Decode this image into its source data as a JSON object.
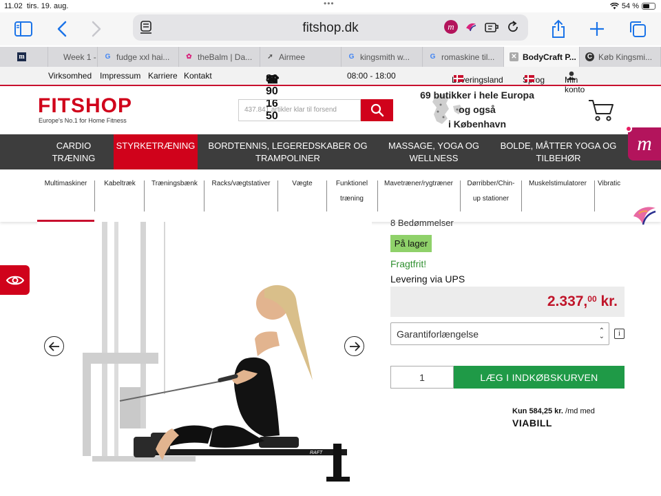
{
  "status": {
    "time": "11.02",
    "date": "tirs. 19. aug.",
    "battery": "54 %"
  },
  "browser": {
    "url": "fitshop.dk",
    "tabs": [
      {
        "label": "",
        "favicon": "m"
      },
      {
        "label": "Week 1 -",
        "favicon": ""
      },
      {
        "label": "fudge xxl hai...",
        "favicon": "G"
      },
      {
        "label": "theBalm | Da...",
        "favicon": "pink"
      },
      {
        "label": "Airmee",
        "favicon": "arrow"
      },
      {
        "label": "kingsmith w...",
        "favicon": "G"
      },
      {
        "label": "romaskine til...",
        "favicon": "G"
      },
      {
        "label": "BodyCraft P...",
        "favicon": "x",
        "active": true
      },
      {
        "label": "Køb Kingsmi...",
        "favicon": "C"
      }
    ]
  },
  "topbar": {
    "links": [
      "Virksomhed",
      "Impressum",
      "Karriere",
      "Kontakt"
    ],
    "phone": "80 90 16 50",
    "hours": "08:00 - 18:00",
    "country_label": "Leveringsland",
    "language_label": "Sprog",
    "account_label": "Min konto"
  },
  "header": {
    "logo": "FITSHOP",
    "tagline": "Europe's No.1 for Home Fitness",
    "search_placeholder": "437.841 artikler klar til forsend",
    "stores_line1": "69 butikker i hele Europa",
    "stores_line2": "og også",
    "stores_line3": "i København"
  },
  "mainnav": [
    {
      "line1": "CARDIO",
      "line2": "TRÆNING"
    },
    {
      "line1": "STYRKETRÆNING",
      "line2": "",
      "active": true
    },
    {
      "line1": "BORDTENNIS, LEGEREDSKABER OG",
      "line2": "TRAMPOLINER"
    },
    {
      "line1": "MASSAGE, YOGA OG",
      "line2": "WELLNESS"
    },
    {
      "line1": "BOLDE, MÅTTER YOGA OG",
      "line2": "TILBEHØR"
    }
  ],
  "subnav": [
    {
      "line1": "Multimaskiner",
      "line2": ""
    },
    {
      "line1": "Kabeltræk",
      "line2": ""
    },
    {
      "line1": "Træningsbænk",
      "line2": ""
    },
    {
      "line1": "Racks/vægtstativer",
      "line2": ""
    },
    {
      "line1": "Vægte",
      "line2": ""
    },
    {
      "line1": "Funktionel",
      "line2": "træning"
    },
    {
      "line1": "Mavetræner/rygtræner",
      "line2": ""
    },
    {
      "line1": "Dørribber/Chin-",
      "line2": "up stationer"
    },
    {
      "line1": "Muskelstimulatorer",
      "line2": ""
    },
    {
      "line1": "Vibratic",
      "line2": ""
    }
  ],
  "product": {
    "ratings": "8 Bedømmelser",
    "stock": "På lager",
    "shipping": "Fragtfrit!",
    "delivery": "Levering via UPS",
    "price_main": "2.337,",
    "price_cents": "00",
    "price_currency": " kr.",
    "warranty_label": "Garantiforlængelse",
    "quantity": "1",
    "add_to_cart": "LÆG I INDKØBSKURVEN",
    "installment_amount": "Kun 584,25 kr.",
    "installment_suffix": " /md med",
    "installment_provider": "VIABILL",
    "machine_brand": "RAFT"
  },
  "colors": {
    "brand_red": "#d0021b",
    "cart_green": "#1f9a47",
    "stock_green": "#8fd16a",
    "price_red": "#c0152a",
    "nav_dark": "#3d3d3d"
  }
}
